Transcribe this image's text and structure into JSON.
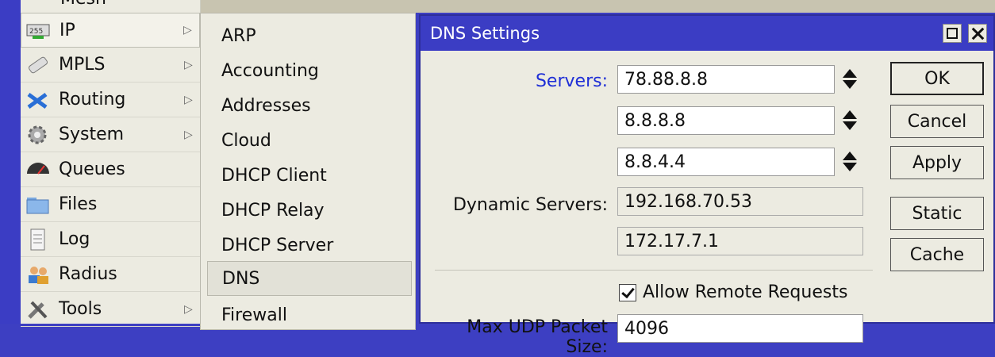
{
  "main_menu": {
    "top_partial": "Mesh",
    "items": [
      {
        "label": "IP",
        "icon": "ip-icon",
        "arrow": "▷",
        "active": true
      },
      {
        "label": "MPLS",
        "icon": "mpls-icon",
        "arrow": "▷"
      },
      {
        "label": "Routing",
        "icon": "routing-icon",
        "arrow": "▷"
      },
      {
        "label": "System",
        "icon": "gear-icon",
        "arrow": "▷"
      },
      {
        "label": "Queues",
        "icon": "queues-icon",
        "arrow": ""
      },
      {
        "label": "Files",
        "icon": "folder-icon",
        "arrow": ""
      },
      {
        "label": "Log",
        "icon": "log-icon",
        "arrow": ""
      },
      {
        "label": "Radius",
        "icon": "radius-icon",
        "arrow": ""
      },
      {
        "label": "Tools",
        "icon": "tools-icon",
        "arrow": "▷"
      }
    ]
  },
  "sub_menu": {
    "items": [
      {
        "label": "ARP"
      },
      {
        "label": "Accounting"
      },
      {
        "label": "Addresses"
      },
      {
        "label": "Cloud"
      },
      {
        "label": "DHCP Client"
      },
      {
        "label": "DHCP Relay"
      },
      {
        "label": "DHCP Server"
      },
      {
        "label": "DNS",
        "active": true
      },
      {
        "label": "Firewall"
      }
    ]
  },
  "dialog": {
    "title": "DNS Settings",
    "servers_label": "Servers:",
    "servers": [
      "78.88.8.8",
      "8.8.8.8",
      "8.8.4.4"
    ],
    "dynamic_label": "Dynamic Servers:",
    "dynamic": [
      "192.168.70.53",
      "172.17.7.1"
    ],
    "allow_remote_label": "Allow Remote Requests",
    "allow_remote_checked": true,
    "max_udp_label": "Max UDP Packet Size:",
    "max_udp_value": "4096",
    "buttons": {
      "ok": "OK",
      "cancel": "Cancel",
      "apply": "Apply",
      "static": "Static",
      "cache": "Cache"
    }
  }
}
